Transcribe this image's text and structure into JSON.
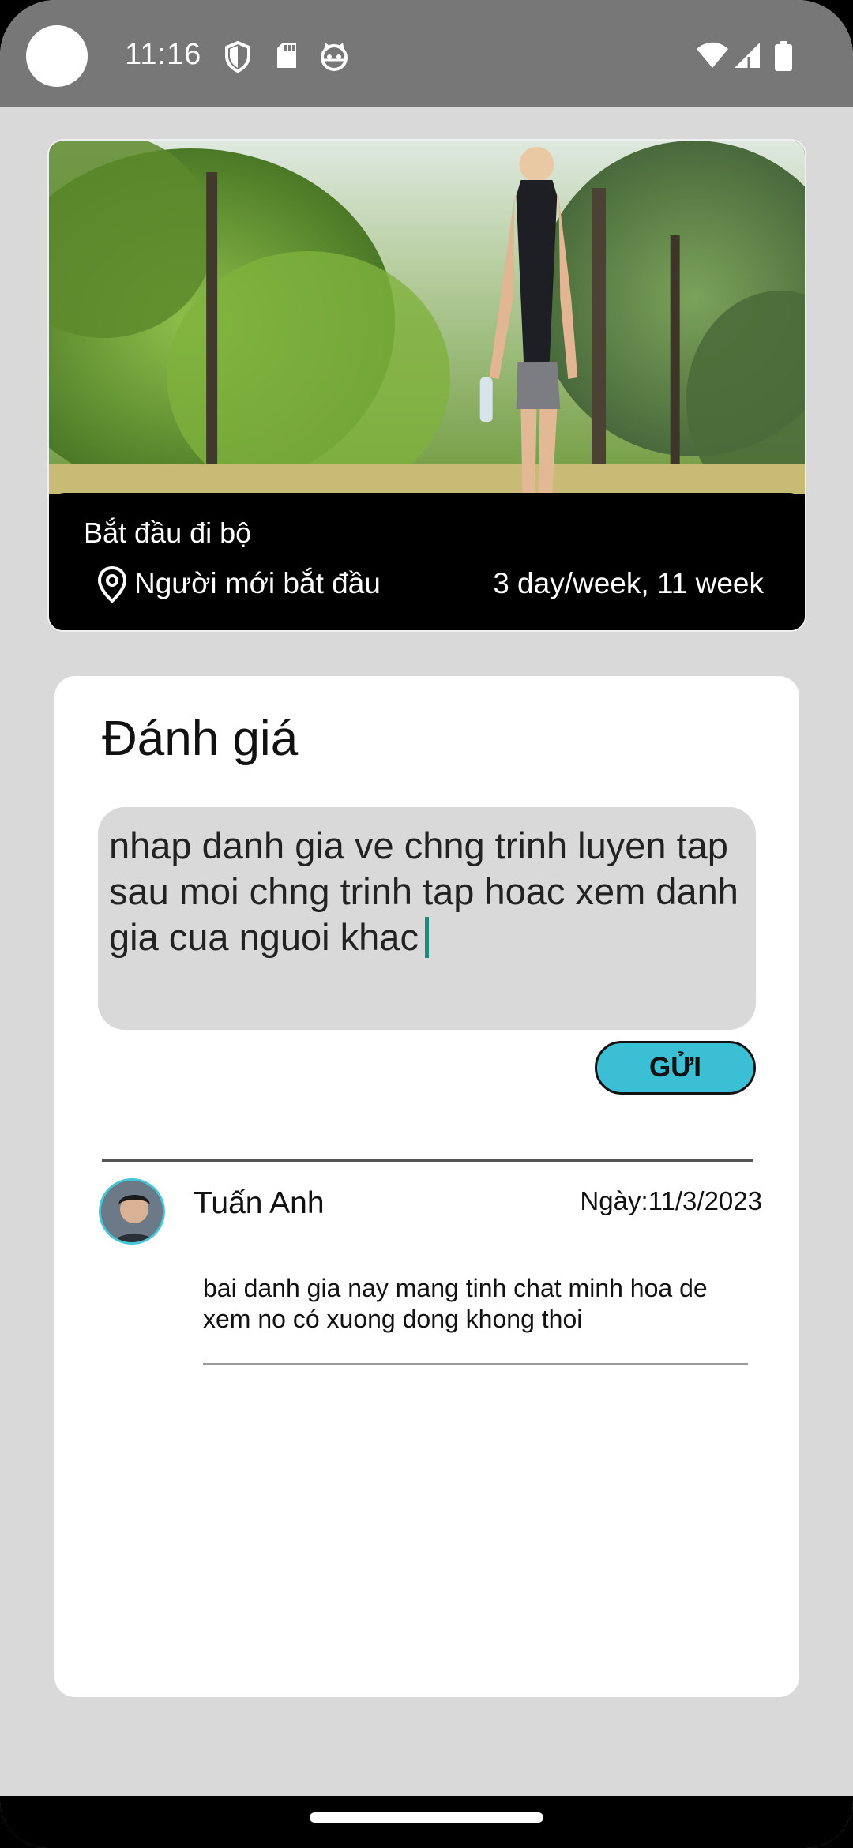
{
  "status_bar": {
    "time": "11:16",
    "icons_left": [
      "shield-icon",
      "sd-card-icon",
      "cat-face-icon"
    ],
    "icons_right": [
      "wifi-icon",
      "signal-icon",
      "battery-icon"
    ]
  },
  "workout": {
    "title": "Bắt đầu đi bộ",
    "level": "Người mới bắt đầu",
    "schedule": "3 day/week, 11 week",
    "photo": "woman walking in forest"
  },
  "review": {
    "heading": "Đánh giá",
    "input_text": "nhap danh gia ve chng trinh luyen tap sau moi chng trinh tap hoac xem danh gia cua nguoi khac",
    "send_label": "GỬI"
  },
  "comments": [
    {
      "name": "Tuấn Anh",
      "date": "Ngày:11/3/2023",
      "text": "bai danh gia nay mang tinh chat minh hoa de xem no có xuong dong khong thoi"
    }
  ],
  "colors": {
    "accent": "#3bbfd4",
    "caret": "#1c8a80",
    "status_bar": "#777777",
    "background": "#d9d9d9"
  }
}
